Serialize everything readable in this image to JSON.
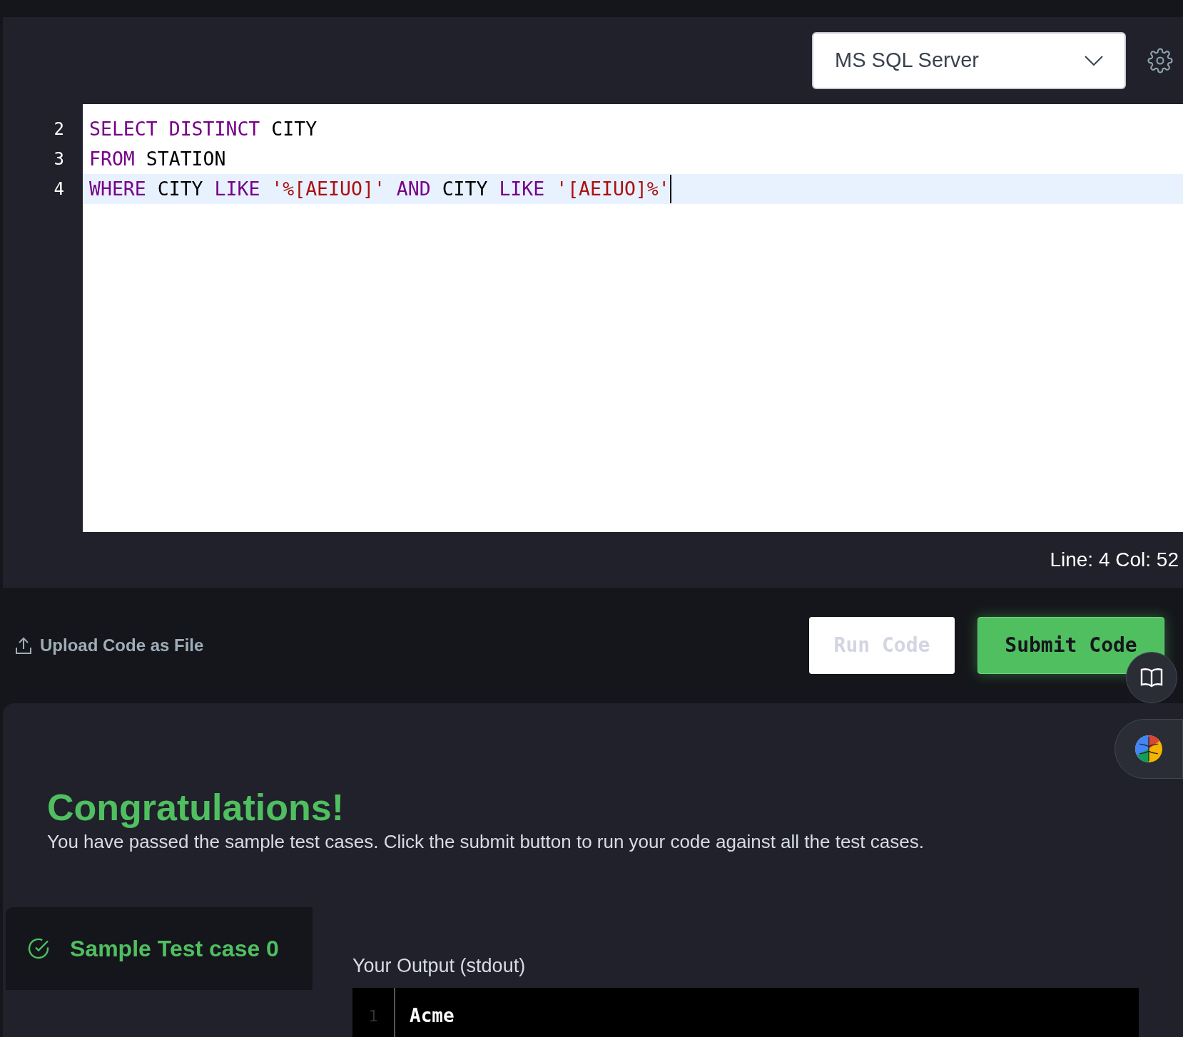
{
  "editor": {
    "language": "MS SQL Server",
    "lines": [
      {
        "number": "2",
        "current": false,
        "tokens": [
          {
            "kind": "keyword",
            "text": "SELECT DISTINCT"
          },
          {
            "kind": "plain",
            "text": " CITY"
          }
        ]
      },
      {
        "number": "3",
        "current": false,
        "tokens": [
          {
            "kind": "keyword",
            "text": "FROM"
          },
          {
            "kind": "plain",
            "text": " STATION"
          }
        ]
      },
      {
        "number": "4",
        "current": true,
        "tokens": [
          {
            "kind": "keyword",
            "text": "WHERE"
          },
          {
            "kind": "plain",
            "text": " CITY "
          },
          {
            "kind": "keyword",
            "text": "LIKE "
          },
          {
            "kind": "string",
            "text": "'%[AEIUO]'"
          },
          {
            "kind": "keyword",
            "text": " AND"
          },
          {
            "kind": "plain",
            "text": " CITY "
          },
          {
            "kind": "keyword",
            "text": "LIKE "
          },
          {
            "kind": "string",
            "text": "'[AEIUO]%'"
          }
        ]
      }
    ],
    "status": "Line: 4 Col: 52"
  },
  "actions": {
    "upload": "Upload Code as File",
    "run": "Run Code",
    "submit": "Submit Code"
  },
  "result": {
    "title": "Congratulations!",
    "message": "You have passed the sample test cases. Click the submit button to run your code against all the test cases.",
    "test_cases": [
      {
        "label": "Sample Test case 0",
        "passed": true,
        "selected": true
      }
    ],
    "output_label": "Your Output (stdout)",
    "output_lines": [
      {
        "number": "1",
        "text": "Acme"
      }
    ]
  }
}
